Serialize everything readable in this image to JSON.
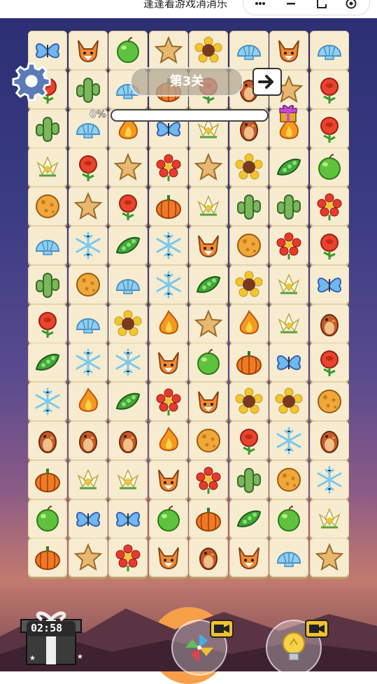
{
  "app": {
    "title": "逢逢着游戏消消乐"
  },
  "level": {
    "label": "第3关"
  },
  "progress": {
    "label": "0%",
    "value": 0
  },
  "timer": {
    "value": "02:58"
  },
  "colors": {
    "tile": "#f7ecd0",
    "progress": "#6fc24a",
    "video_badge": "#f3c12c"
  },
  "board": {
    "rows": 14,
    "cols": 8,
    "tiles": [
      [
        "butterfly",
        "fox",
        "apple",
        "star",
        "sunflower",
        "shell",
        "fox",
        "shell"
      ],
      [
        "rose",
        "cactus",
        "shell",
        "pumpkin",
        "rose",
        "robin",
        "star",
        "rose"
      ],
      [
        "cactus",
        "shell",
        "fire",
        "butterfly",
        "lily",
        "robin",
        "fire",
        "rose"
      ],
      [
        "lily",
        "rose",
        "star",
        "flower",
        "star",
        "sunflower",
        "peapod",
        "apple"
      ],
      [
        "cheese",
        "star",
        "rose",
        "pumpkin",
        "lily",
        "cactus",
        "cactus",
        "flower"
      ],
      [
        "shell",
        "snowflake",
        "peapod",
        "snowflake",
        "fox",
        "cheese",
        "flower",
        "rose"
      ],
      [
        "cactus",
        "cheese",
        "shell",
        "snowflake",
        "peapod",
        "sunflower",
        "lily",
        "butterfly"
      ],
      [
        "rose",
        "shell",
        "sunflower",
        "fire",
        "star",
        "fire",
        "lily",
        "robin"
      ],
      [
        "peapod",
        "snowflake",
        "snowflake",
        "fox",
        "apple",
        "pumpkin",
        "butterfly",
        "rose"
      ],
      [
        "snowflake",
        "fire",
        "peapod",
        "flower",
        "fox",
        "sunflower",
        "sunflower",
        "cheese"
      ],
      [
        "robin",
        "robin",
        "robin",
        "fire",
        "cheese",
        "rose",
        "snowflake",
        "robin"
      ],
      [
        "pumpkin",
        "lily",
        "lily",
        "fox",
        "flower",
        "cactus",
        "cheese",
        "snowflake"
      ],
      [
        "apple",
        "butterfly",
        "butterfly",
        "apple",
        "pumpkin",
        "peapod",
        "apple",
        "lily"
      ],
      [
        "pumpkin",
        "star",
        "flower",
        "fox",
        "robin",
        "fox",
        "shell",
        "star"
      ]
    ]
  },
  "icons": {
    "settings": "gear-icon",
    "next": "arrow-right-icon",
    "gift": "gift-icon",
    "shuffle": "pinwheel-icon",
    "hint": "lightbulb-icon",
    "video": "video-camera-icon"
  }
}
